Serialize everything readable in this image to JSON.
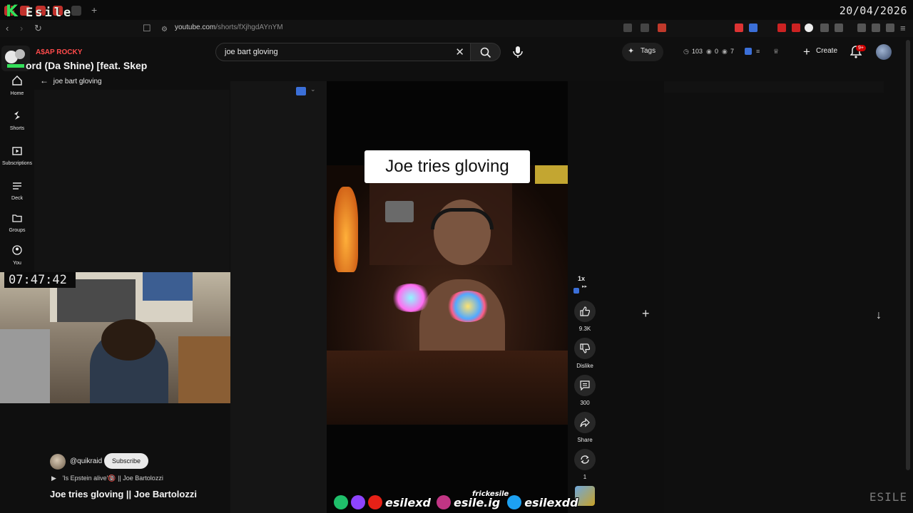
{
  "browser": {
    "logo_k": "K",
    "logo_text": "Esile",
    "new_tab": "+",
    "date": "20/04/2026",
    "url_host": "youtube.com",
    "url_path": "/shorts/fXjhgdAYnYM"
  },
  "header": {
    "search_value": "joe bart gloving",
    "tags_label": "Tags",
    "stat_1": "103",
    "stat_2": "0",
    "stat_3": "7",
    "create_label": "Create",
    "notifications_badge": "9+"
  },
  "now_playing": {
    "artist": "A$AP ROCKY",
    "song": "ord (Da Shine) [feat. Skep"
  },
  "sidebar": {
    "items": [
      {
        "label": "Home",
        "icon": "home-icon"
      },
      {
        "label": "Shorts",
        "icon": "shorts-icon"
      },
      {
        "label": "Subscriptions",
        "icon": "subscriptions-icon"
      },
      {
        "label": "Deck",
        "icon": "deck-icon"
      },
      {
        "label": "Groups",
        "icon": "groups-icon"
      },
      {
        "label": "You",
        "icon": "you-icon"
      }
    ]
  },
  "search_back": {
    "label": "joe bart gloving"
  },
  "webcam": {
    "timer": "07:47:42"
  },
  "video": {
    "caption": "Joe tries gloving",
    "channel": "@quikraid",
    "subscribe_label": "Subscribe",
    "playlist": "'Is Epstein alive'🔞 || Joe Bartolozzi",
    "title": "Joe tries gloving || Joe Bartolozzi"
  },
  "actions": {
    "speed": "1x",
    "likes": "9.3K",
    "dislike": "Dislike",
    "comments": "300",
    "share": "Share",
    "remix": "1"
  },
  "socials": {
    "handle_main": "esilexd",
    "handle_ig": "esile.ig",
    "handle_twitter": "esilexdd",
    "frick": "frickesile"
  },
  "watermark": "ESILE",
  "colors": {
    "background": "#0f0f0f",
    "accent_red": "#cc0000",
    "logo_green": "#34e05a"
  }
}
